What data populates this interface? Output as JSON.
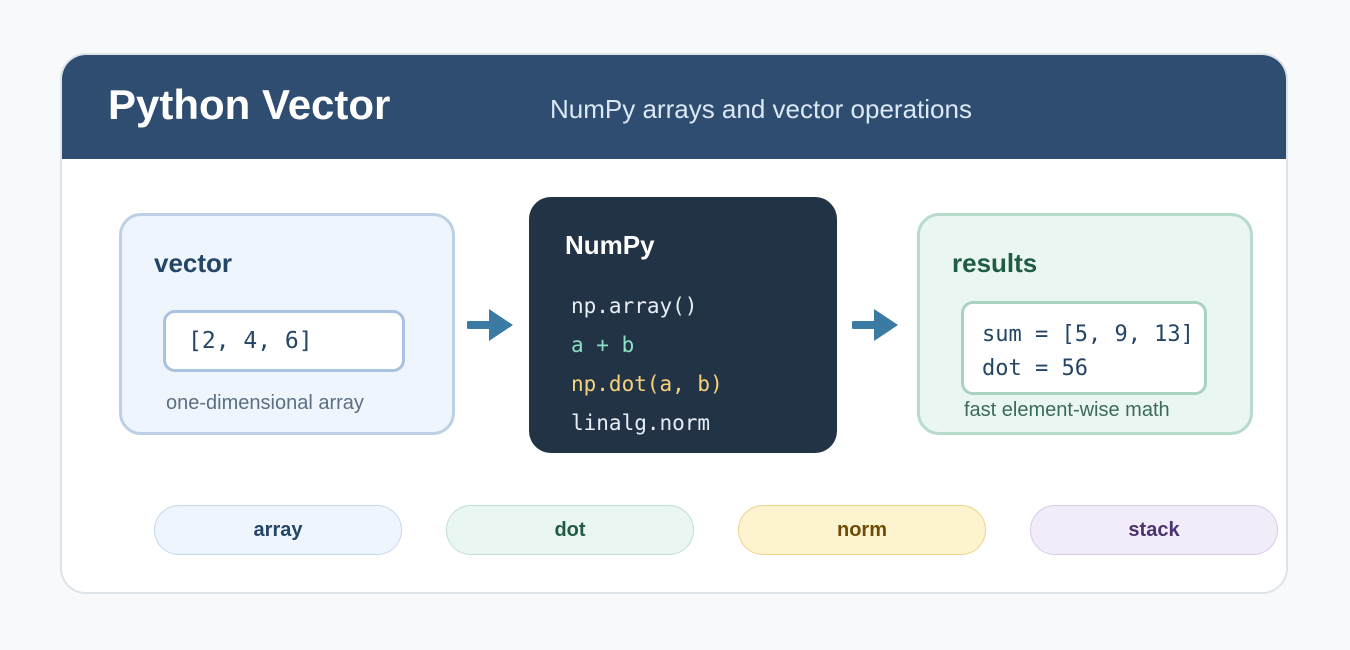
{
  "header": {
    "title": "Python Vector",
    "subtitle": "NumPy arrays and vector operations"
  },
  "vector_box": {
    "title": "vector",
    "value": "[2, 4, 6]",
    "caption": "one-dimensional array"
  },
  "numpy_box": {
    "title": "NumPy",
    "items": [
      {
        "text": "np.array()",
        "color": "#e8eef5"
      },
      {
        "text": "a + b",
        "color": "#8be0c4"
      },
      {
        "text": "np.dot(a, b)",
        "color": "#f7d27a"
      },
      {
        "text": "linalg.norm",
        "color": "#e8eef5"
      }
    ]
  },
  "results_box": {
    "title": "results",
    "lines": [
      "sum = [5, 9, 13]",
      "dot = 56"
    ],
    "caption": "fast element-wise math"
  },
  "arrow_color": "#3a7aa3",
  "pills": [
    {
      "label": "array",
      "bg": "#eef5fd",
      "border": "#c6d8ee",
      "color": "#244566"
    },
    {
      "label": "dot",
      "bg": "#eaf6f1",
      "border": "#bfe0d2",
      "color": "#1f5c44"
    },
    {
      "label": "norm",
      "bg": "#fdf3cf",
      "border": "#ecd48e",
      "color": "#6b4d07"
    },
    {
      "label": "stack",
      "bg": "#f1ecf8",
      "border": "#d6cbe8",
      "color": "#4a3470"
    }
  ]
}
